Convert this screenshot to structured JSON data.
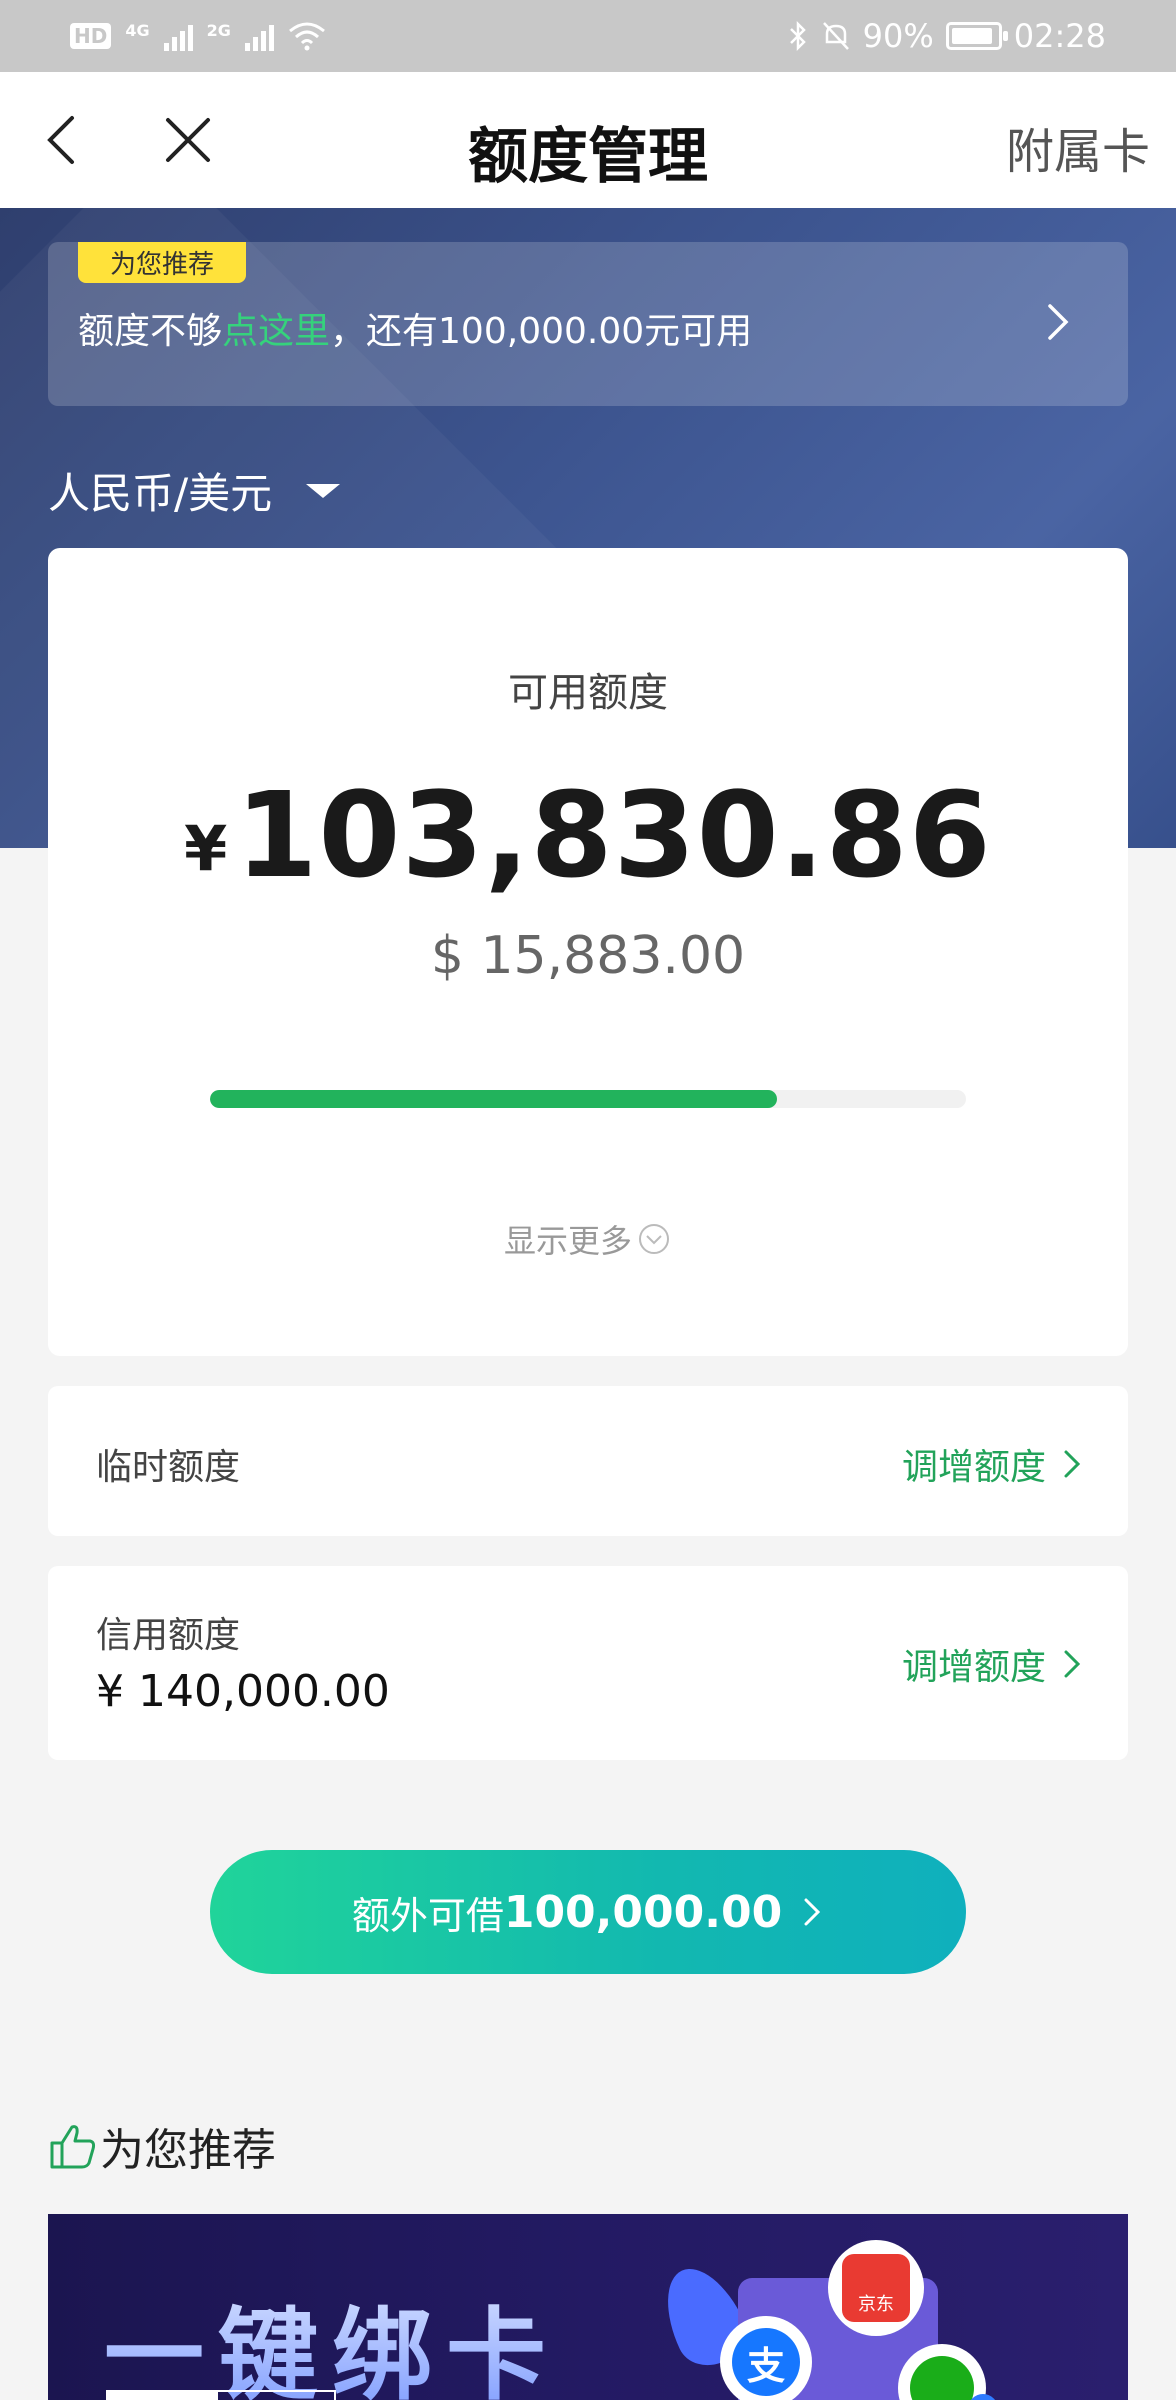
{
  "status_bar": {
    "hd": "HD",
    "sim1": "4G",
    "sim2": "2G",
    "battery": "90%",
    "time": "02:28"
  },
  "nav": {
    "title": "额度管理",
    "right_action": "附属卡"
  },
  "promo": {
    "tag": "为您推荐",
    "text_before": "额度不够",
    "text_link": "点这里",
    "text_after": "，还有100,000.00元可用"
  },
  "currency_selector": {
    "selected": "人民币/美元"
  },
  "available": {
    "label": "可用额度",
    "cny_symbol": "¥",
    "cny_amount": "103,830.86",
    "usd_amount": "$ 15,883.00",
    "progress_fraction": 0.75,
    "show_more": "显示更多"
  },
  "temp_limit": {
    "label": "临时额度",
    "action": "调增额度"
  },
  "credit_limit": {
    "label": "信用额度",
    "value": "¥ 140,000.00",
    "action": "调增额度"
  },
  "cta": {
    "prefix": "额外可借",
    "amount": "100,000.00"
  },
  "recommend": {
    "title": "为您推荐",
    "banner_title": "一键绑卡",
    "banner_jd_label": "京东",
    "banner_ali_label": "支"
  },
  "colors": {
    "accent_green": "#22b35c",
    "promo_tag_yellow": "#ffe23a",
    "hero_blue": "#3d5590"
  }
}
